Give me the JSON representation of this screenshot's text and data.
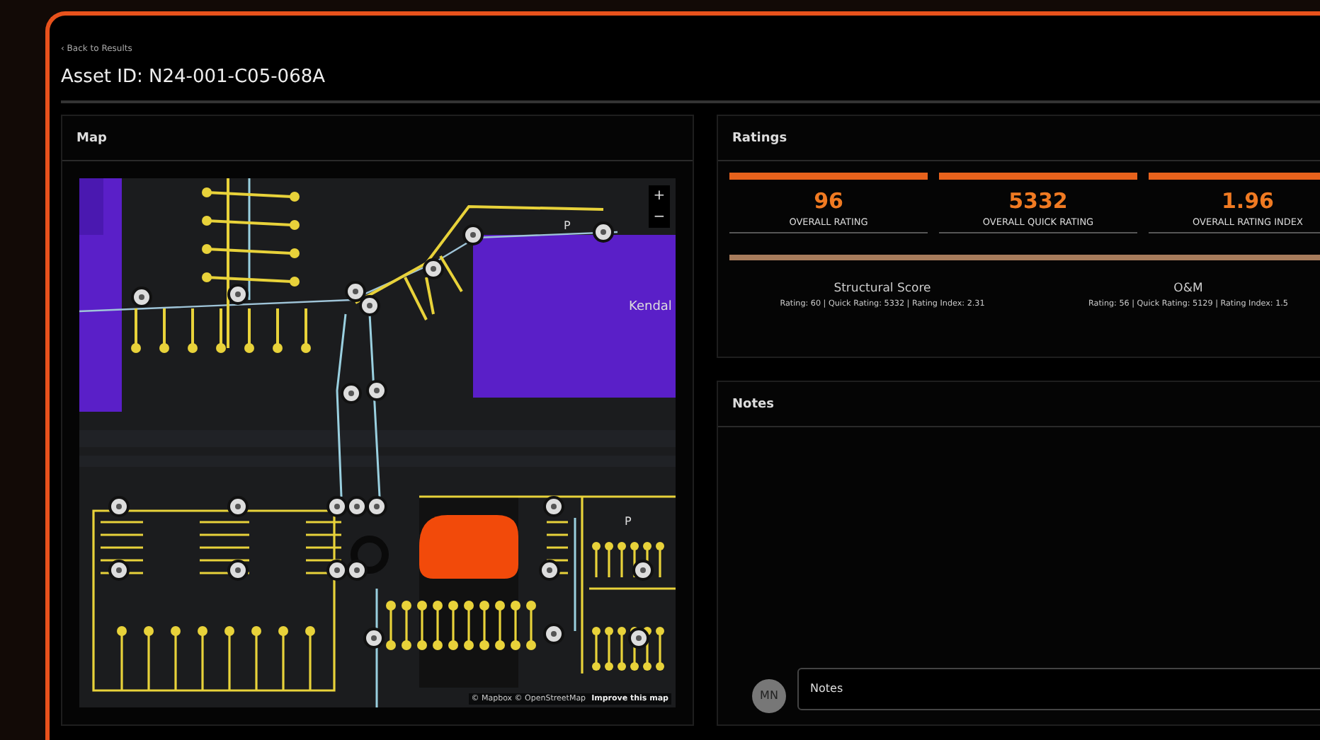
{
  "back_link": "‹ Back to Results",
  "title": "Asset ID: N24-001-C05-068A",
  "map": {
    "title": "Map",
    "zoom_in": "+",
    "zoom_out": "−",
    "labels": [
      "P",
      "Kendal",
      "P"
    ],
    "attribution": "© Mapbox © OpenStreetMap",
    "improve_link": "Improve this map"
  },
  "ratings": {
    "title": "Ratings",
    "tiles": [
      {
        "value": "96",
        "label": "OVERALL RATING"
      },
      {
        "value": "5332",
        "label": "OVERALL QUICK RATING"
      },
      {
        "value": "1.96",
        "label": "OVERALL RATING INDEX"
      }
    ],
    "scores": [
      {
        "name": "Structural Score",
        "detail": "Rating: 60 | Quick Rating: 5332 | Rating Index: 2.31"
      },
      {
        "name": "O&M",
        "detail": "Rating: 56 | Quick Rating: 5129 | Rating Index: 1.5"
      }
    ]
  },
  "notes": {
    "title": "Notes",
    "avatar": "MN",
    "placeholder": "Notes"
  }
}
